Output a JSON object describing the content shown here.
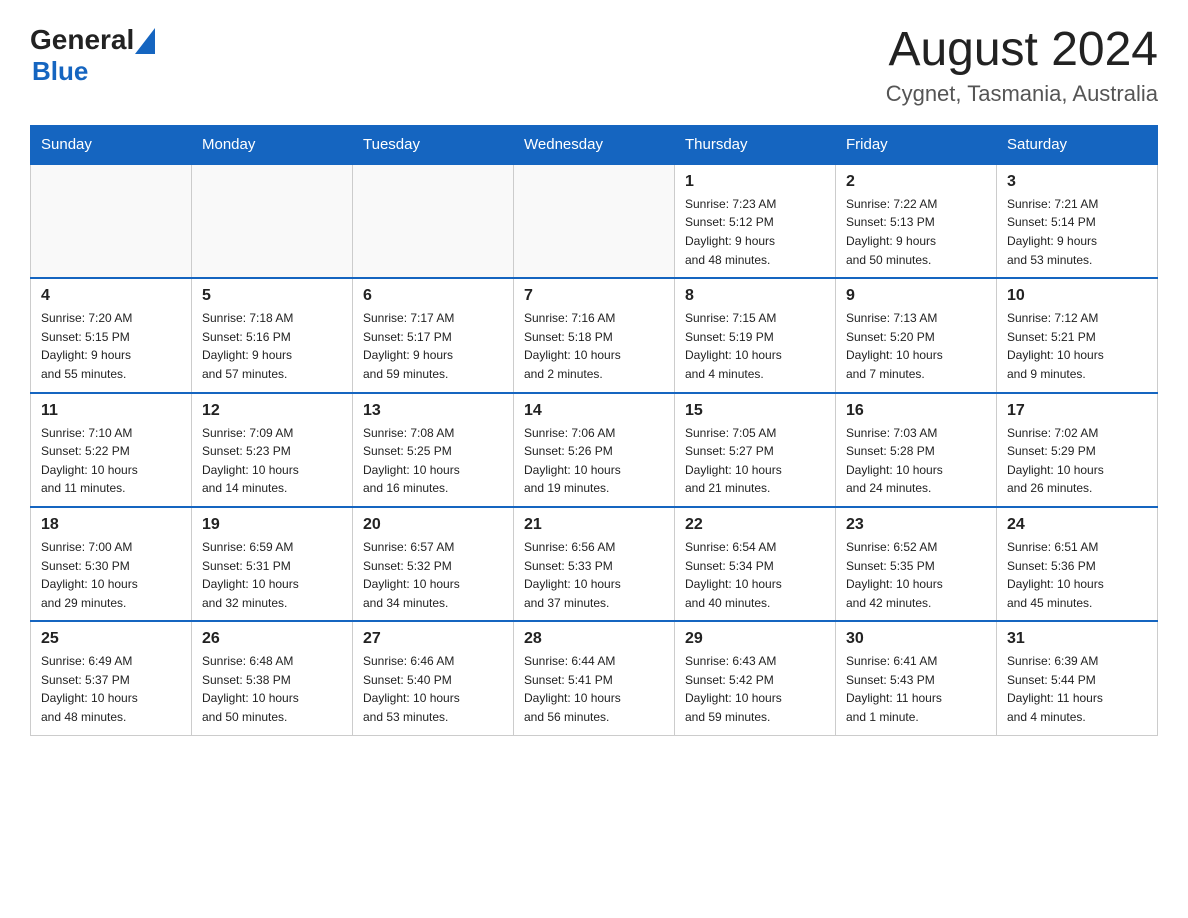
{
  "header": {
    "logo_general": "General",
    "logo_blue": "Blue",
    "month_title": "August 2024",
    "location": "Cygnet, Tasmania, Australia"
  },
  "columns": [
    "Sunday",
    "Monday",
    "Tuesday",
    "Wednesday",
    "Thursday",
    "Friday",
    "Saturday"
  ],
  "weeks": [
    [
      {
        "day": "",
        "info": ""
      },
      {
        "day": "",
        "info": ""
      },
      {
        "day": "",
        "info": ""
      },
      {
        "day": "",
        "info": ""
      },
      {
        "day": "1",
        "info": "Sunrise: 7:23 AM\nSunset: 5:12 PM\nDaylight: 9 hours\nand 48 minutes."
      },
      {
        "day": "2",
        "info": "Sunrise: 7:22 AM\nSunset: 5:13 PM\nDaylight: 9 hours\nand 50 minutes."
      },
      {
        "day": "3",
        "info": "Sunrise: 7:21 AM\nSunset: 5:14 PM\nDaylight: 9 hours\nand 53 minutes."
      }
    ],
    [
      {
        "day": "4",
        "info": "Sunrise: 7:20 AM\nSunset: 5:15 PM\nDaylight: 9 hours\nand 55 minutes."
      },
      {
        "day": "5",
        "info": "Sunrise: 7:18 AM\nSunset: 5:16 PM\nDaylight: 9 hours\nand 57 minutes."
      },
      {
        "day": "6",
        "info": "Sunrise: 7:17 AM\nSunset: 5:17 PM\nDaylight: 9 hours\nand 59 minutes."
      },
      {
        "day": "7",
        "info": "Sunrise: 7:16 AM\nSunset: 5:18 PM\nDaylight: 10 hours\nand 2 minutes."
      },
      {
        "day": "8",
        "info": "Sunrise: 7:15 AM\nSunset: 5:19 PM\nDaylight: 10 hours\nand 4 minutes."
      },
      {
        "day": "9",
        "info": "Sunrise: 7:13 AM\nSunset: 5:20 PM\nDaylight: 10 hours\nand 7 minutes."
      },
      {
        "day": "10",
        "info": "Sunrise: 7:12 AM\nSunset: 5:21 PM\nDaylight: 10 hours\nand 9 minutes."
      }
    ],
    [
      {
        "day": "11",
        "info": "Sunrise: 7:10 AM\nSunset: 5:22 PM\nDaylight: 10 hours\nand 11 minutes."
      },
      {
        "day": "12",
        "info": "Sunrise: 7:09 AM\nSunset: 5:23 PM\nDaylight: 10 hours\nand 14 minutes."
      },
      {
        "day": "13",
        "info": "Sunrise: 7:08 AM\nSunset: 5:25 PM\nDaylight: 10 hours\nand 16 minutes."
      },
      {
        "day": "14",
        "info": "Sunrise: 7:06 AM\nSunset: 5:26 PM\nDaylight: 10 hours\nand 19 minutes."
      },
      {
        "day": "15",
        "info": "Sunrise: 7:05 AM\nSunset: 5:27 PM\nDaylight: 10 hours\nand 21 minutes."
      },
      {
        "day": "16",
        "info": "Sunrise: 7:03 AM\nSunset: 5:28 PM\nDaylight: 10 hours\nand 24 minutes."
      },
      {
        "day": "17",
        "info": "Sunrise: 7:02 AM\nSunset: 5:29 PM\nDaylight: 10 hours\nand 26 minutes."
      }
    ],
    [
      {
        "day": "18",
        "info": "Sunrise: 7:00 AM\nSunset: 5:30 PM\nDaylight: 10 hours\nand 29 minutes."
      },
      {
        "day": "19",
        "info": "Sunrise: 6:59 AM\nSunset: 5:31 PM\nDaylight: 10 hours\nand 32 minutes."
      },
      {
        "day": "20",
        "info": "Sunrise: 6:57 AM\nSunset: 5:32 PM\nDaylight: 10 hours\nand 34 minutes."
      },
      {
        "day": "21",
        "info": "Sunrise: 6:56 AM\nSunset: 5:33 PM\nDaylight: 10 hours\nand 37 minutes."
      },
      {
        "day": "22",
        "info": "Sunrise: 6:54 AM\nSunset: 5:34 PM\nDaylight: 10 hours\nand 40 minutes."
      },
      {
        "day": "23",
        "info": "Sunrise: 6:52 AM\nSunset: 5:35 PM\nDaylight: 10 hours\nand 42 minutes."
      },
      {
        "day": "24",
        "info": "Sunrise: 6:51 AM\nSunset: 5:36 PM\nDaylight: 10 hours\nand 45 minutes."
      }
    ],
    [
      {
        "day": "25",
        "info": "Sunrise: 6:49 AM\nSunset: 5:37 PM\nDaylight: 10 hours\nand 48 minutes."
      },
      {
        "day": "26",
        "info": "Sunrise: 6:48 AM\nSunset: 5:38 PM\nDaylight: 10 hours\nand 50 minutes."
      },
      {
        "day": "27",
        "info": "Sunrise: 6:46 AM\nSunset: 5:40 PM\nDaylight: 10 hours\nand 53 minutes."
      },
      {
        "day": "28",
        "info": "Sunrise: 6:44 AM\nSunset: 5:41 PM\nDaylight: 10 hours\nand 56 minutes."
      },
      {
        "day": "29",
        "info": "Sunrise: 6:43 AM\nSunset: 5:42 PM\nDaylight: 10 hours\nand 59 minutes."
      },
      {
        "day": "30",
        "info": "Sunrise: 6:41 AM\nSunset: 5:43 PM\nDaylight: 11 hours\nand 1 minute."
      },
      {
        "day": "31",
        "info": "Sunrise: 6:39 AM\nSunset: 5:44 PM\nDaylight: 11 hours\nand 4 minutes."
      }
    ]
  ]
}
